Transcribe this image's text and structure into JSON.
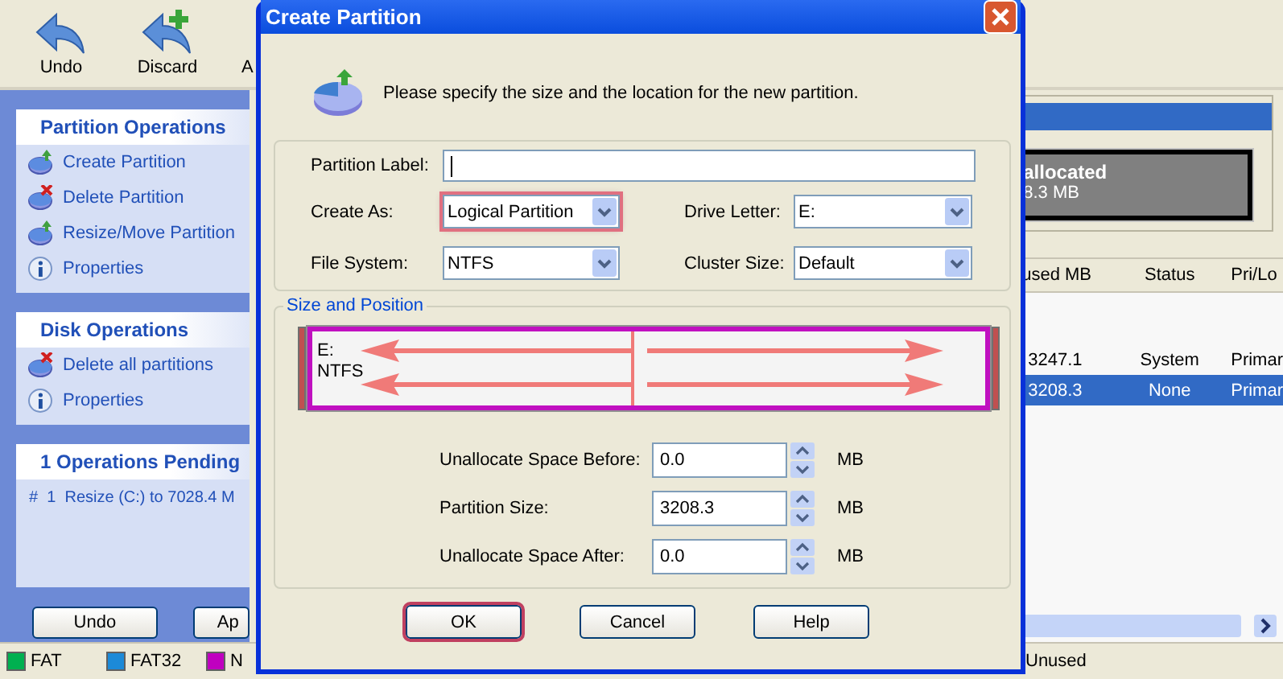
{
  "toolbar": [
    {
      "label": "Undo",
      "kind": "undo"
    },
    {
      "label": "Discard",
      "kind": "discard"
    },
    {
      "label": "A",
      "kind": "apply"
    }
  ],
  "sidebar": {
    "panels": [
      {
        "title": "Partition Operations",
        "items": [
          {
            "label": "Create Partition",
            "kind": "create"
          },
          {
            "label": "Delete Partition",
            "kind": "delete"
          },
          {
            "label": "Resize/Move Partition",
            "kind": "resize"
          },
          {
            "label": "Properties",
            "kind": "info"
          }
        ]
      },
      {
        "title": "Disk Operations",
        "items": [
          {
            "label": "Delete all partitions",
            "kind": "delete"
          },
          {
            "label": "Properties",
            "kind": "info"
          }
        ]
      }
    ],
    "pending": {
      "title": "1 Operations Pending",
      "items": [
        "#  1  Resize (C:) to 7028.4 M"
      ]
    },
    "buttons": [
      "Undo",
      "Ap"
    ]
  },
  "disk_map": {
    "label": "allocated",
    "size": "8.3 MB"
  },
  "table": {
    "columns": [
      "used MB",
      "Status",
      "Pri/Lo"
    ],
    "rows": [
      {
        "cells": [
          "3247.1",
          "System",
          "Primar"
        ],
        "selected": false
      },
      {
        "cells": [
          "3208.3",
          "None",
          "Primar"
        ],
        "selected": true
      }
    ]
  },
  "legend": [
    {
      "label": "FAT",
      "color": "#00b050"
    },
    {
      "label": "FAT32",
      "color": "#1c8ad8"
    },
    {
      "label": "N",
      "color": "#c000c0"
    }
  ],
  "legend_right": "Unused",
  "dialog": {
    "title": "Create Partition",
    "message": "Please specify the size and the location for the new partition.",
    "label_field": {
      "label": "Partition Label:"
    },
    "combos": [
      {
        "label": "Create As:",
        "value": "Logical Partition",
        "highlighted": true
      },
      {
        "label": "Drive Letter:",
        "value": "E:",
        "highlighted": false
      },
      {
        "label": "File System:",
        "value": "NTFS",
        "highlighted": false
      },
      {
        "label": "Cluster Size:",
        "value": "Default",
        "highlighted": false
      }
    ],
    "size_position": {
      "title": "Size and Position",
      "drive": "E:",
      "file_system": "NTFS"
    },
    "spins": [
      {
        "label": "Unallocate Space Before:",
        "value": "0.0",
        "unit": "MB"
      },
      {
        "label": "Partition Size:",
        "value": "3208.3",
        "unit": "MB"
      },
      {
        "label": "Unallocate Space After:",
        "value": "0.0",
        "unit": "MB"
      }
    ],
    "buttons": [
      {
        "label": "OK",
        "highlighted": true
      },
      {
        "label": "Cancel",
        "highlighted": false
      },
      {
        "label": "Help",
        "highlighted": false
      }
    ]
  }
}
